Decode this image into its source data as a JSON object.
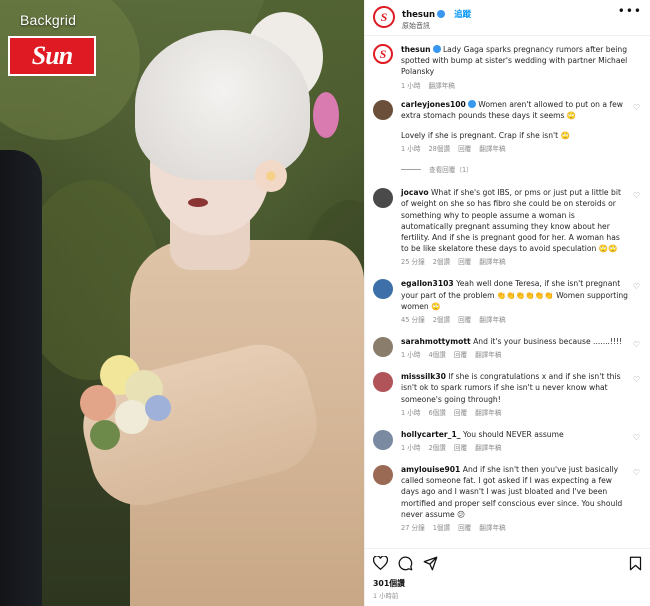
{
  "photo": {
    "credit": "Backgrid",
    "logo_text": "Sun",
    "logo_tag": "THE"
  },
  "header": {
    "username": "thesun",
    "follow_label": "追蹤",
    "subtitle": "原始音訊",
    "more_icon": "more-horizontal-icon"
  },
  "caption": {
    "username": "thesun",
    "text": "Lady Gaga sparks pregnancy rumors after being spotted with bump at sister's wedding with partner Michael Polansky",
    "time": "1 小時"
  },
  "comments": [
    {
      "username": "carleyjones100",
      "text": "Women aren't allowed to put on a few extra stomach pounds these days it seems 🙄",
      "text2": "Lovely if she is pregnant. Crap if she isn't 🙄",
      "time": "1 小時",
      "likes": "28個讚",
      "reply": "回覆",
      "translate": "翻譯年稿",
      "view_replies": "查看回覆（1）",
      "avatar_color": "#6b4f3a"
    },
    {
      "username": "jocavo",
      "text": "What if she's got IBS, or pms or just put a little bit of weight on she so has fibro she could be on steroids or something why to people assume a woman is automatically pregnant assuming they know about her fertility. And if she is pregnant good for her. A woman has to be like skelatore these days to avoid speculation 🙄🙄",
      "time": "25 分鐘",
      "likes": "2個讚",
      "reply": "回覆",
      "translate": "翻譯年稿",
      "avatar_color": "#4a4a4a"
    },
    {
      "username": "egallon3103",
      "text": "Yeah well done Teresa, if she isn't pregnant your part of the problem 👏👏👏👏👏👏 Women supporting women 🙄",
      "time": "45 分鐘",
      "likes": "2個讚",
      "reply": "回覆",
      "translate": "翻譯年稿",
      "avatar_color": "#3d6fa8"
    },
    {
      "username": "sarahmottymott",
      "text": "And it's your business because .......!!!!",
      "time": "1 小時",
      "likes": "4個讚",
      "reply": "回覆",
      "translate": "翻譯年稿",
      "avatar_color": "#8a7d6c"
    },
    {
      "username": "misssilk30",
      "text": "If she is congratulations x and if she isn't this isn't ok to spark rumors if she isn't u never know what someone's going through!",
      "time": "1 小時",
      "likes": "6個讚",
      "reply": "回覆",
      "translate": "翻譯年稿",
      "avatar_color": "#b0545a"
    },
    {
      "username": "hollycarter_1_",
      "text": "You should NEVER assume",
      "time": "1 小時",
      "likes": "2個讚",
      "reply": "回覆",
      "translate": "翻譯年稿",
      "avatar_color": "#7a8aa0"
    },
    {
      "username": "amylouise901",
      "text": "And if she isn't then you've just basically called someone fat. I got asked if I was expecting a few days ago and I wasn't I was just bloated and I've been mortified and proper self conscious ever since. You should never assume 😕",
      "time": "27 分鐘",
      "likes": "1個讚",
      "reply": "回覆",
      "translate": "翻譯年稿",
      "avatar_color": "#9a6a55"
    }
  ],
  "footer": {
    "likes": "301個讚",
    "time": "1 小時前"
  }
}
